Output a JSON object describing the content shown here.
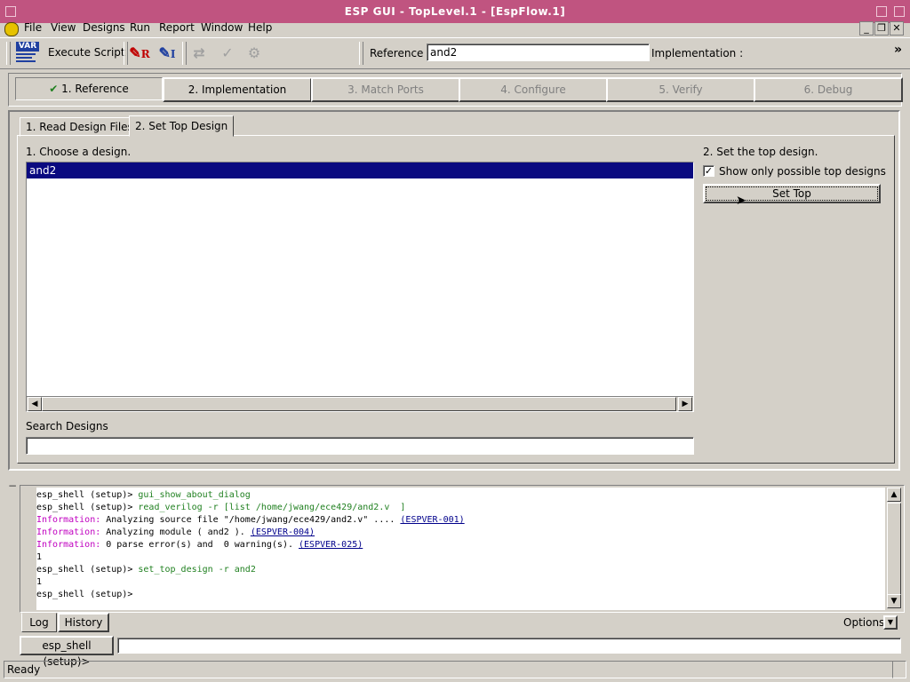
{
  "window": {
    "title": "ESP GUI - TopLevel.1 - [EspFlow.1]"
  },
  "menubar": {
    "items": [
      "File",
      "View",
      "Designs",
      "Run",
      "Report",
      "Window",
      "Help"
    ]
  },
  "toolbar": {
    "execute_script_label": "Execute Script",
    "var_icon_text": "VAR",
    "reference_label": "Reference :",
    "reference_value": "and2",
    "implementation_label": "Implementation :",
    "overflow": "»"
  },
  "flow_steps": [
    {
      "label": "1. Reference",
      "state": "active"
    },
    {
      "label": "2. Implementation",
      "state": "enabled"
    },
    {
      "label": "3. Match Ports",
      "state": "disabled"
    },
    {
      "label": "4. Configure",
      "state": "disabled"
    },
    {
      "label": "5. Verify",
      "state": "disabled"
    },
    {
      "label": "6. Debug",
      "state": "disabled"
    }
  ],
  "tabs": [
    {
      "label": "1. Read Design Files",
      "selected": false
    },
    {
      "label": "2. Set Top Design",
      "selected": true
    }
  ],
  "design_panel": {
    "choose_label": "1. Choose a design.",
    "designs": [
      "and2"
    ],
    "selected_design": "and2",
    "search_label": "Search Designs",
    "search_value": ""
  },
  "top_panel": {
    "heading": "2. Set the top design.",
    "checkbox_label": "Show only possible top designs",
    "checkbox_checked": true,
    "set_top_button": "Set Top"
  },
  "log": {
    "lines": [
      [
        {
          "t": "esp_shell (setup)> ",
          "c": ""
        },
        {
          "t": "gui_show_about_dialog",
          "c": "cmd"
        }
      ],
      [
        {
          "t": "esp_shell (setup)> ",
          "c": ""
        },
        {
          "t": "read_verilog -r [list /home/jwang/ece429/and2.v  ]",
          "c": "cmd"
        }
      ],
      [
        {
          "t": "Information:",
          "c": "info"
        },
        {
          "t": " Analyzing source file \"/home/jwang/ece429/and2.v\" .... ",
          "c": ""
        },
        {
          "t": "(ESPVER-001)",
          "c": "link"
        }
      ],
      [
        {
          "t": "Information:",
          "c": "info"
        },
        {
          "t": " Analyzing module ( and2 ). ",
          "c": ""
        },
        {
          "t": "(ESPVER-004)",
          "c": "link"
        }
      ],
      [
        {
          "t": "Information:",
          "c": "info"
        },
        {
          "t": " 0 parse error(s) and  0 warning(s). ",
          "c": ""
        },
        {
          "t": "(ESPVER-025)",
          "c": "link"
        }
      ],
      [
        {
          "t": "1",
          "c": ""
        }
      ],
      [
        {
          "t": "esp_shell (setup)> ",
          "c": ""
        },
        {
          "t": "set_top_design -r and2",
          "c": "cmd"
        }
      ],
      [
        {
          "t": "1",
          "c": ""
        }
      ],
      [
        {
          "t": "esp_shell (setup)> ",
          "c": ""
        }
      ]
    ],
    "tabs": [
      "Log",
      "History"
    ],
    "options_label": "Options:"
  },
  "command": {
    "prompt_label": "esp_shell (setup)>",
    "value": ""
  },
  "status": {
    "text": "Ready"
  }
}
